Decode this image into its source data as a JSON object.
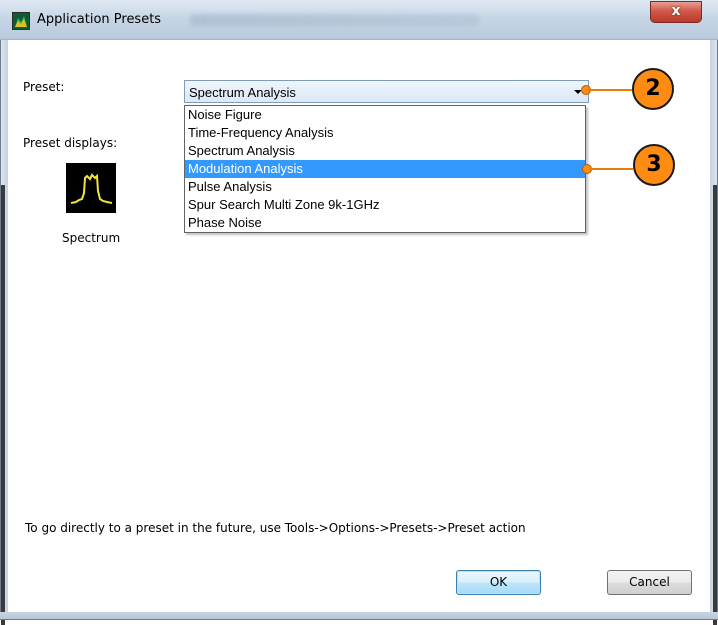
{
  "window": {
    "title": "Application Presets",
    "close_label": "x"
  },
  "preset": {
    "label": "Preset:",
    "selected_value": "Spectrum Analysis",
    "options": [
      "Noise Figure",
      "Time-Frequency Analysis",
      "Spectrum Analysis",
      "Modulation Analysis",
      "Pulse Analysis",
      "Spur Search Multi Zone 9k-1GHz",
      "Phase Noise"
    ],
    "highlighted_option": "Modulation Analysis"
  },
  "preset_displays": {
    "label": "Preset displays:",
    "items": [
      {
        "caption": "Spectrum",
        "icon": "spectrum-display-icon"
      }
    ]
  },
  "hint": "To go directly to a preset in the future, use Tools->Options->Presets->Preset action",
  "buttons": {
    "ok": "OK",
    "cancel": "Cancel"
  },
  "callouts": [
    "2",
    "3"
  ],
  "colors": {
    "callout": "#ff8c12",
    "selection": "#3399ff",
    "close_button": "#c8473a"
  }
}
